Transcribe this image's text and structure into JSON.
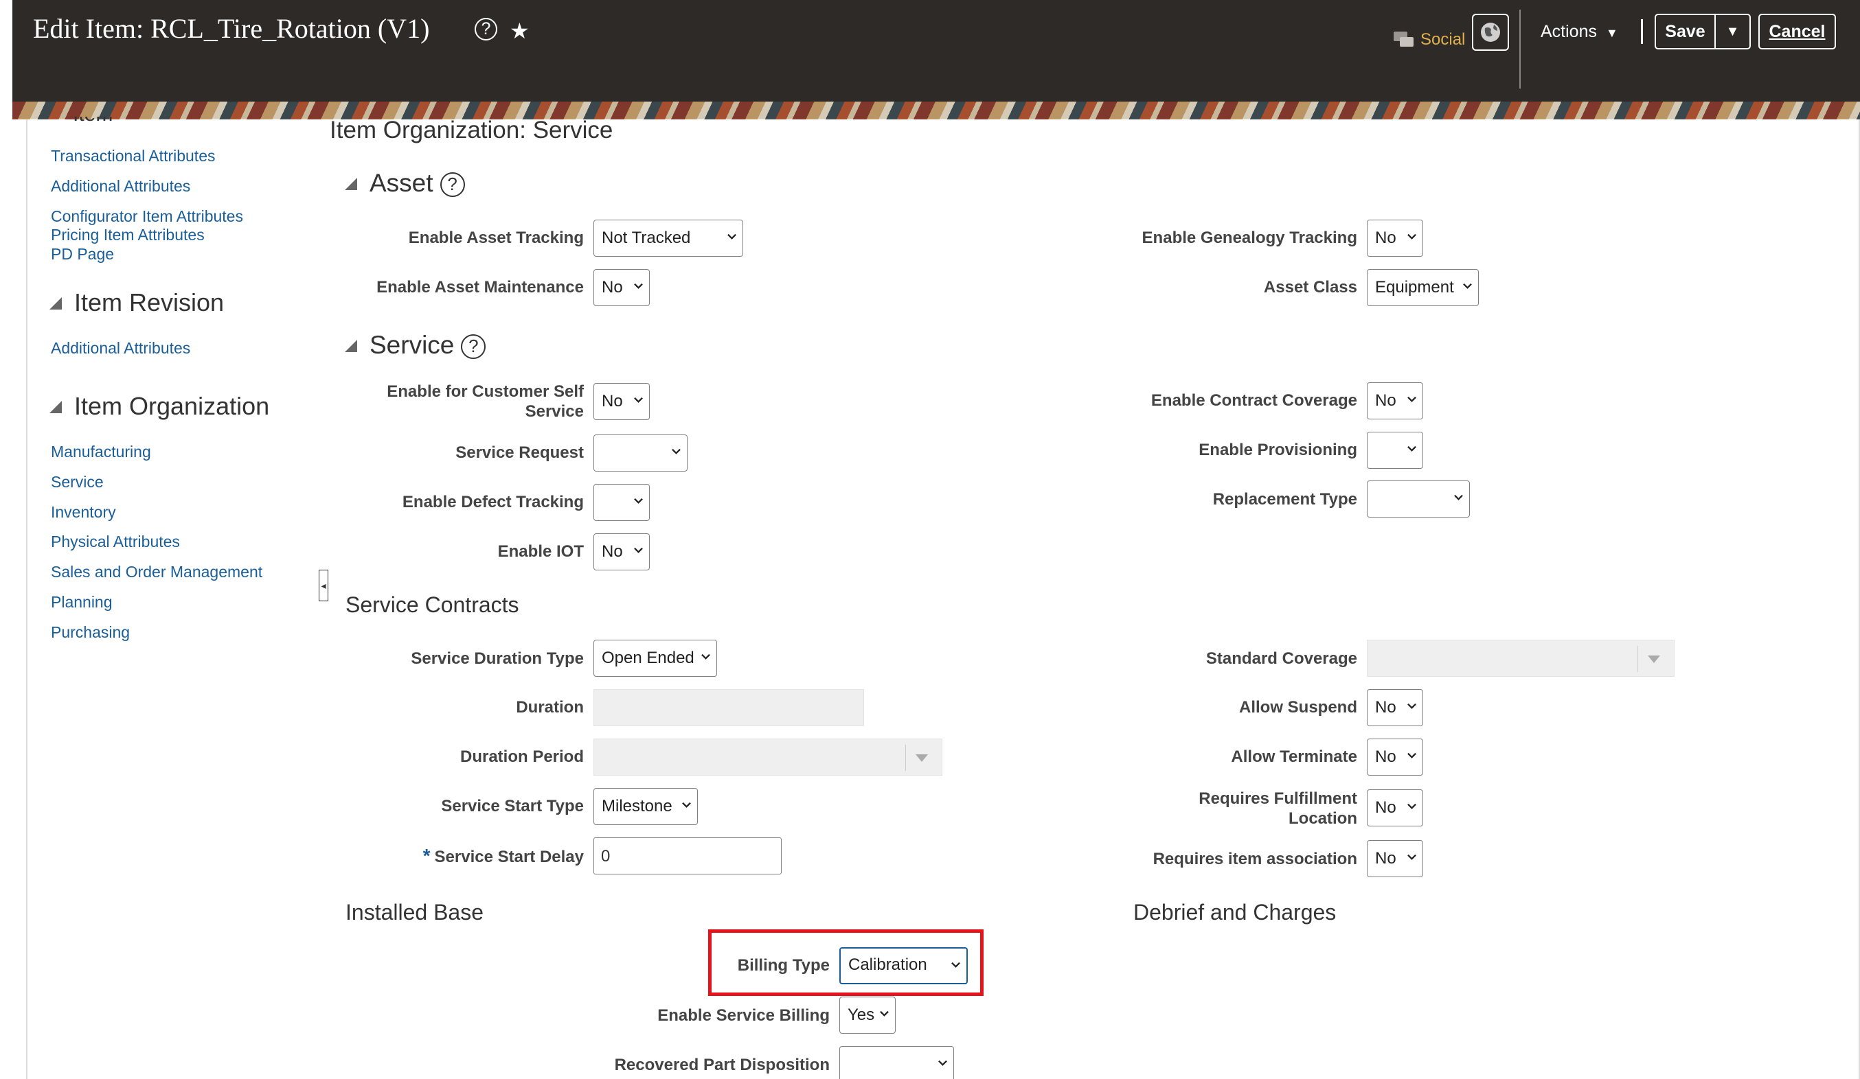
{
  "header": {
    "title": "Edit Item: RCL_Tire_Rotation (V1)",
    "social_label": "Social",
    "actions_label": "Actions",
    "save_label": "Save",
    "cancel_label": "Cancel"
  },
  "sidebar": {
    "cut_heading": "Item",
    "item_links": [
      "Transactional Attributes",
      "Additional Attributes",
      "Configurator Item Attributes",
      "Pricing Item Attributes",
      "PD Page"
    ],
    "revision_heading": "Item Revision",
    "revision_links": [
      "Additional Attributes"
    ],
    "organization_heading": "Item Organization",
    "organization_links": [
      "Manufacturing",
      "Service",
      "Inventory",
      "Physical Attributes",
      "Sales and Order Management",
      "Planning",
      "Purchasing"
    ]
  },
  "main": {
    "page_heading": "Item Organization: Service",
    "asset": {
      "heading": "Asset",
      "enable_asset_tracking": {
        "label": "Enable Asset Tracking",
        "value": "Not Tracked"
      },
      "enable_asset_maintenance": {
        "label": "Enable Asset Maintenance",
        "value": "No"
      },
      "enable_genealogy_tracking": {
        "label": "Enable Genealogy Tracking",
        "value": "No"
      },
      "asset_class": {
        "label": "Asset Class",
        "value": "Equipment"
      }
    },
    "service": {
      "heading": "Service",
      "enable_customer_self_service": {
        "label_line1": "Enable for Customer Self",
        "label_line2": "Service",
        "value": "No"
      },
      "service_request": {
        "label": "Service Request",
        "value": ""
      },
      "enable_defect_tracking": {
        "label": "Enable Defect Tracking",
        "value": ""
      },
      "enable_iot": {
        "label": "Enable IOT",
        "value": "No"
      },
      "enable_contract_coverage": {
        "label": "Enable Contract Coverage",
        "value": "No"
      },
      "enable_provisioning": {
        "label": "Enable Provisioning",
        "value": ""
      },
      "replacement_type": {
        "label": "Replacement Type",
        "value": ""
      }
    },
    "service_contracts": {
      "heading": "Service Contracts",
      "service_duration_type": {
        "label": "Service Duration Type",
        "value": "Open Ended"
      },
      "duration": {
        "label": "Duration",
        "value": ""
      },
      "duration_period": {
        "label": "Duration Period",
        "value": ""
      },
      "service_start_type": {
        "label": "Service Start Type",
        "value": "Milestone"
      },
      "service_start_delay": {
        "label": "Service Start Delay",
        "required_mark": "*",
        "value": "0"
      },
      "standard_coverage": {
        "label": "Standard Coverage",
        "value": ""
      },
      "allow_suspend": {
        "label": "Allow Suspend",
        "value": "No"
      },
      "allow_terminate": {
        "label": "Allow Terminate",
        "value": "No"
      },
      "requires_fulfillment_location": {
        "label_line1": "Requires Fulfillment",
        "label_line2": "Location",
        "value": "No"
      },
      "requires_item_association": {
        "label": "Requires item association",
        "value": "No"
      }
    },
    "installed_base": {
      "heading": "Installed Base",
      "billing_type": {
        "label": "Billing Type",
        "value": "Calibration"
      },
      "enable_service_billing": {
        "label": "Enable Service Billing",
        "value": "Yes"
      },
      "recovered_part_disposition": {
        "label": "Recovered Part Disposition",
        "value": ""
      }
    },
    "debrief_and_charges": {
      "heading": "Debrief and Charges"
    }
  },
  "colors": {
    "header_bg": "#2e2a27",
    "link": "#1a5e99",
    "highlight": "#e5141b",
    "social": "#e0b04d"
  }
}
